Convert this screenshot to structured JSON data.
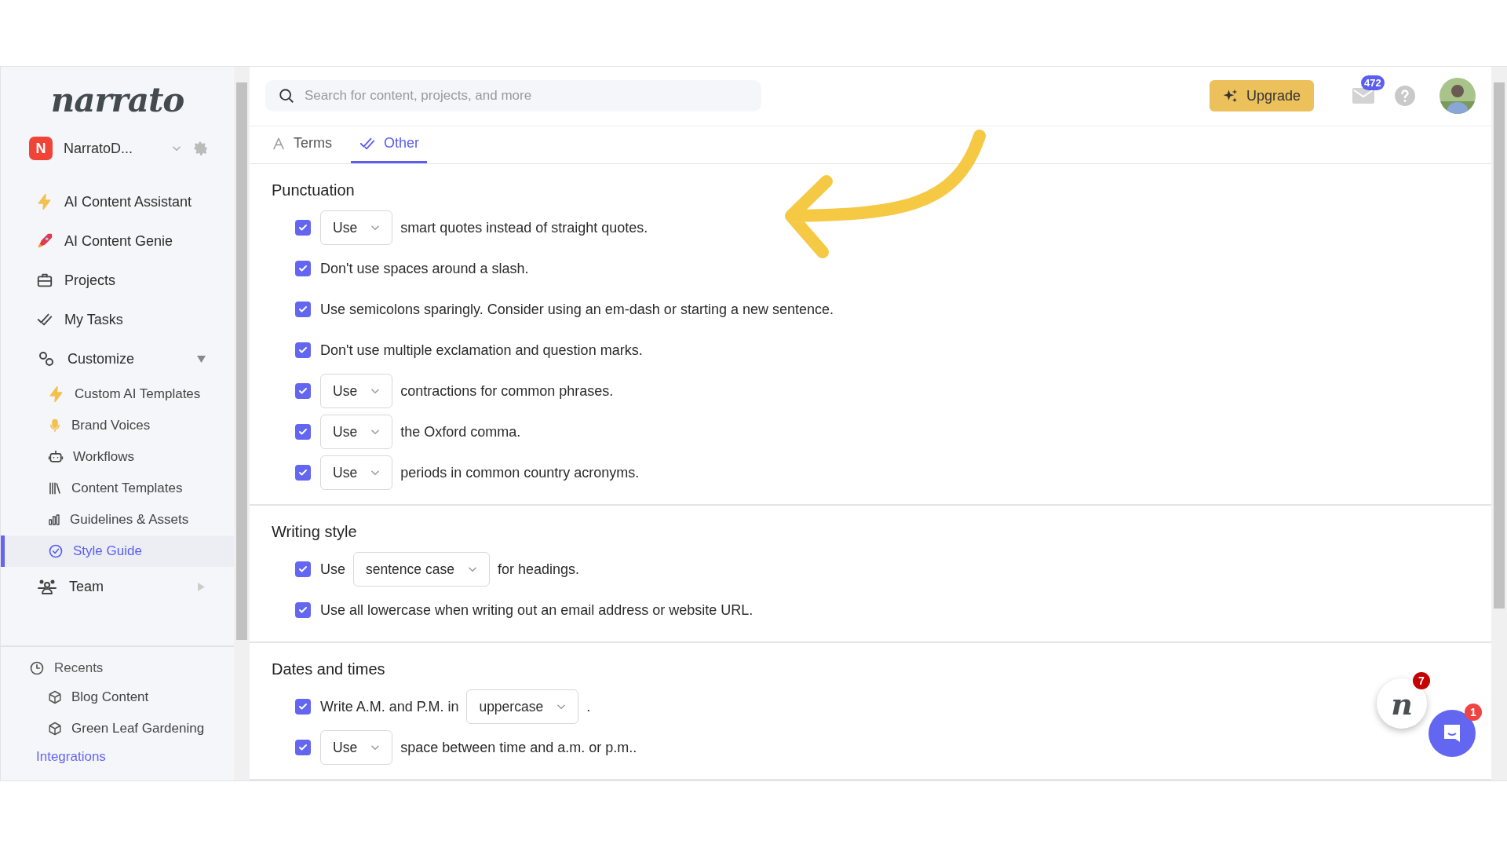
{
  "logo": "narrato",
  "workspace": {
    "initial": "N",
    "name": "NarratoD..."
  },
  "nav": [
    {
      "label": "AI Content Assistant",
      "kind": "bolt",
      "selected": false
    },
    {
      "label": "AI Content Genie",
      "kind": "rocket",
      "selected": false
    },
    {
      "label": "Projects",
      "kind": "briefcase",
      "selected": false
    },
    {
      "label": "My Tasks",
      "kind": "checks",
      "selected": false
    },
    {
      "label": "Customize",
      "kind": "gears",
      "selected": false,
      "expanded": true,
      "children": [
        {
          "label": "Custom AI Templates",
          "kind": "bolt",
          "selected": false
        },
        {
          "label": "Brand Voices",
          "kind": "mic",
          "selected": false
        },
        {
          "label": "Workflows",
          "kind": "robot",
          "selected": false
        },
        {
          "label": "Content Templates",
          "kind": "books",
          "selected": false
        },
        {
          "label": "Guidelines & Assets",
          "kind": "bars",
          "selected": false
        },
        {
          "label": "Style Guide",
          "kind": "badge",
          "selected": true
        }
      ]
    },
    {
      "label": "Team",
      "kind": "team",
      "selected": false,
      "expanded": false
    }
  ],
  "recents": {
    "title": "Recents",
    "items": [
      "Blog Content",
      "Green Leaf Gardening"
    ]
  },
  "integrations": "Integrations",
  "search": {
    "placeholder": "Search for content, projects, and more"
  },
  "upgrade": "Upgrade",
  "mail_count": "472",
  "tabs": [
    {
      "label": "Terms",
      "kind": "letter",
      "selected": false
    },
    {
      "label": "Other",
      "kind": "checks",
      "selected": true
    }
  ],
  "sections": [
    {
      "title": "Punctuation",
      "rules": [
        {
          "checked": true,
          "select": "Use",
          "suffix": "smart quotes instead of straight quotes."
        },
        {
          "checked": true,
          "text": "Don't use spaces around a slash."
        },
        {
          "checked": true,
          "text": "Use semicolons sparingly. Consider using an em-dash or starting a new sentence."
        },
        {
          "checked": true,
          "text": "Don't use multiple exclamation and question marks."
        },
        {
          "checked": true,
          "select": "Use",
          "suffix": "contractions for common phrases."
        },
        {
          "checked": true,
          "select": "Use",
          "suffix": "the Oxford comma."
        },
        {
          "checked": true,
          "select": "Use",
          "suffix": "periods in common country acronyms."
        }
      ]
    },
    {
      "title": "Writing style",
      "rules": [
        {
          "checked": true,
          "prefix": "Use",
          "select": "sentence case",
          "suffix": "for headings."
        },
        {
          "checked": true,
          "text": "Use all lowercase when writing out an email address or website URL."
        }
      ]
    },
    {
      "title": "Dates and times",
      "rules": [
        {
          "checked": true,
          "prefix": "Write A.M. and P.M. in",
          "select": "uppercase",
          "suffix": "."
        },
        {
          "checked": true,
          "select": "Use",
          "suffix": "space between time and a.m. or p.m.."
        }
      ]
    }
  ],
  "chat": {
    "logo": "n",
    "logo_badge": "7",
    "chat_badge": "1"
  }
}
